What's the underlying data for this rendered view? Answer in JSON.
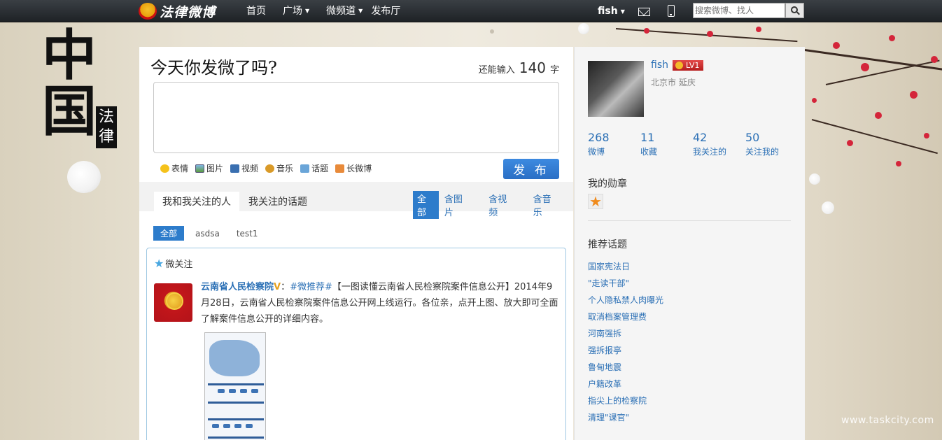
{
  "topbar": {
    "brand": "法律微博",
    "nav": [
      {
        "label": "首页",
        "dropdown": false
      },
      {
        "label": "广场",
        "dropdown": true
      },
      {
        "label": "微频道",
        "dropdown": true
      },
      {
        "label": "发布厅",
        "dropdown": false
      }
    ],
    "user": "fish",
    "search_placeholder": "搜索微博、找人"
  },
  "hero": {
    "china_char": "中国",
    "seal_text": "法律"
  },
  "compose": {
    "title": "今天你发微了吗?",
    "remain_prefix": "还能输入",
    "remain_count": "140",
    "remain_suffix": "字",
    "tools": [
      "表情",
      "图片",
      "视频",
      "音乐",
      "话题",
      "长微博"
    ],
    "publish": "发 布"
  },
  "feed": {
    "tabs": [
      "我和我关注的人",
      "我关注的话题"
    ],
    "filters": [
      "全部",
      "含图片",
      "含视频",
      "含音乐"
    ],
    "groups": [
      "全部",
      "asdsa",
      "test1"
    ],
    "section_title": "微关注",
    "post": {
      "author": "云南省人民检察院",
      "verified": "V",
      "colon": "：",
      "hashtag": "#微推荐#",
      "text": "【一图读懂云南省人民检察院案件信息公开】2014年9月28日，云南省人民检察院案件信息公开网上线运行。各位亲，点开上图、放大即可全面了解案件信息公开的详细内容。"
    }
  },
  "profile": {
    "name": "fish",
    "level": "LV1",
    "location": "北京市 延庆",
    "stats": [
      {
        "count": "268",
        "label": "微博"
      },
      {
        "count": "11",
        "label": "收藏"
      },
      {
        "count": "42",
        "label": "我关注的"
      },
      {
        "count": "50",
        "label": "关注我的"
      }
    ],
    "medals_title": "我的勋章"
  },
  "topics": {
    "title": "推荐话题",
    "items": [
      "国家宪法日",
      "\"走读干部\"",
      "个人隐私禁人肉曝光",
      "取消档案管理费",
      "河南强拆",
      "强拆报亭",
      "鲁甸地震",
      "户籍改革",
      "指尖上的检察院",
      "清理\"课官\""
    ]
  },
  "watermark": "www.taskcity.com",
  "colors": {
    "accent": "#2d7ccb",
    "link": "#2a6fb5",
    "topbar": "#1e2226"
  }
}
